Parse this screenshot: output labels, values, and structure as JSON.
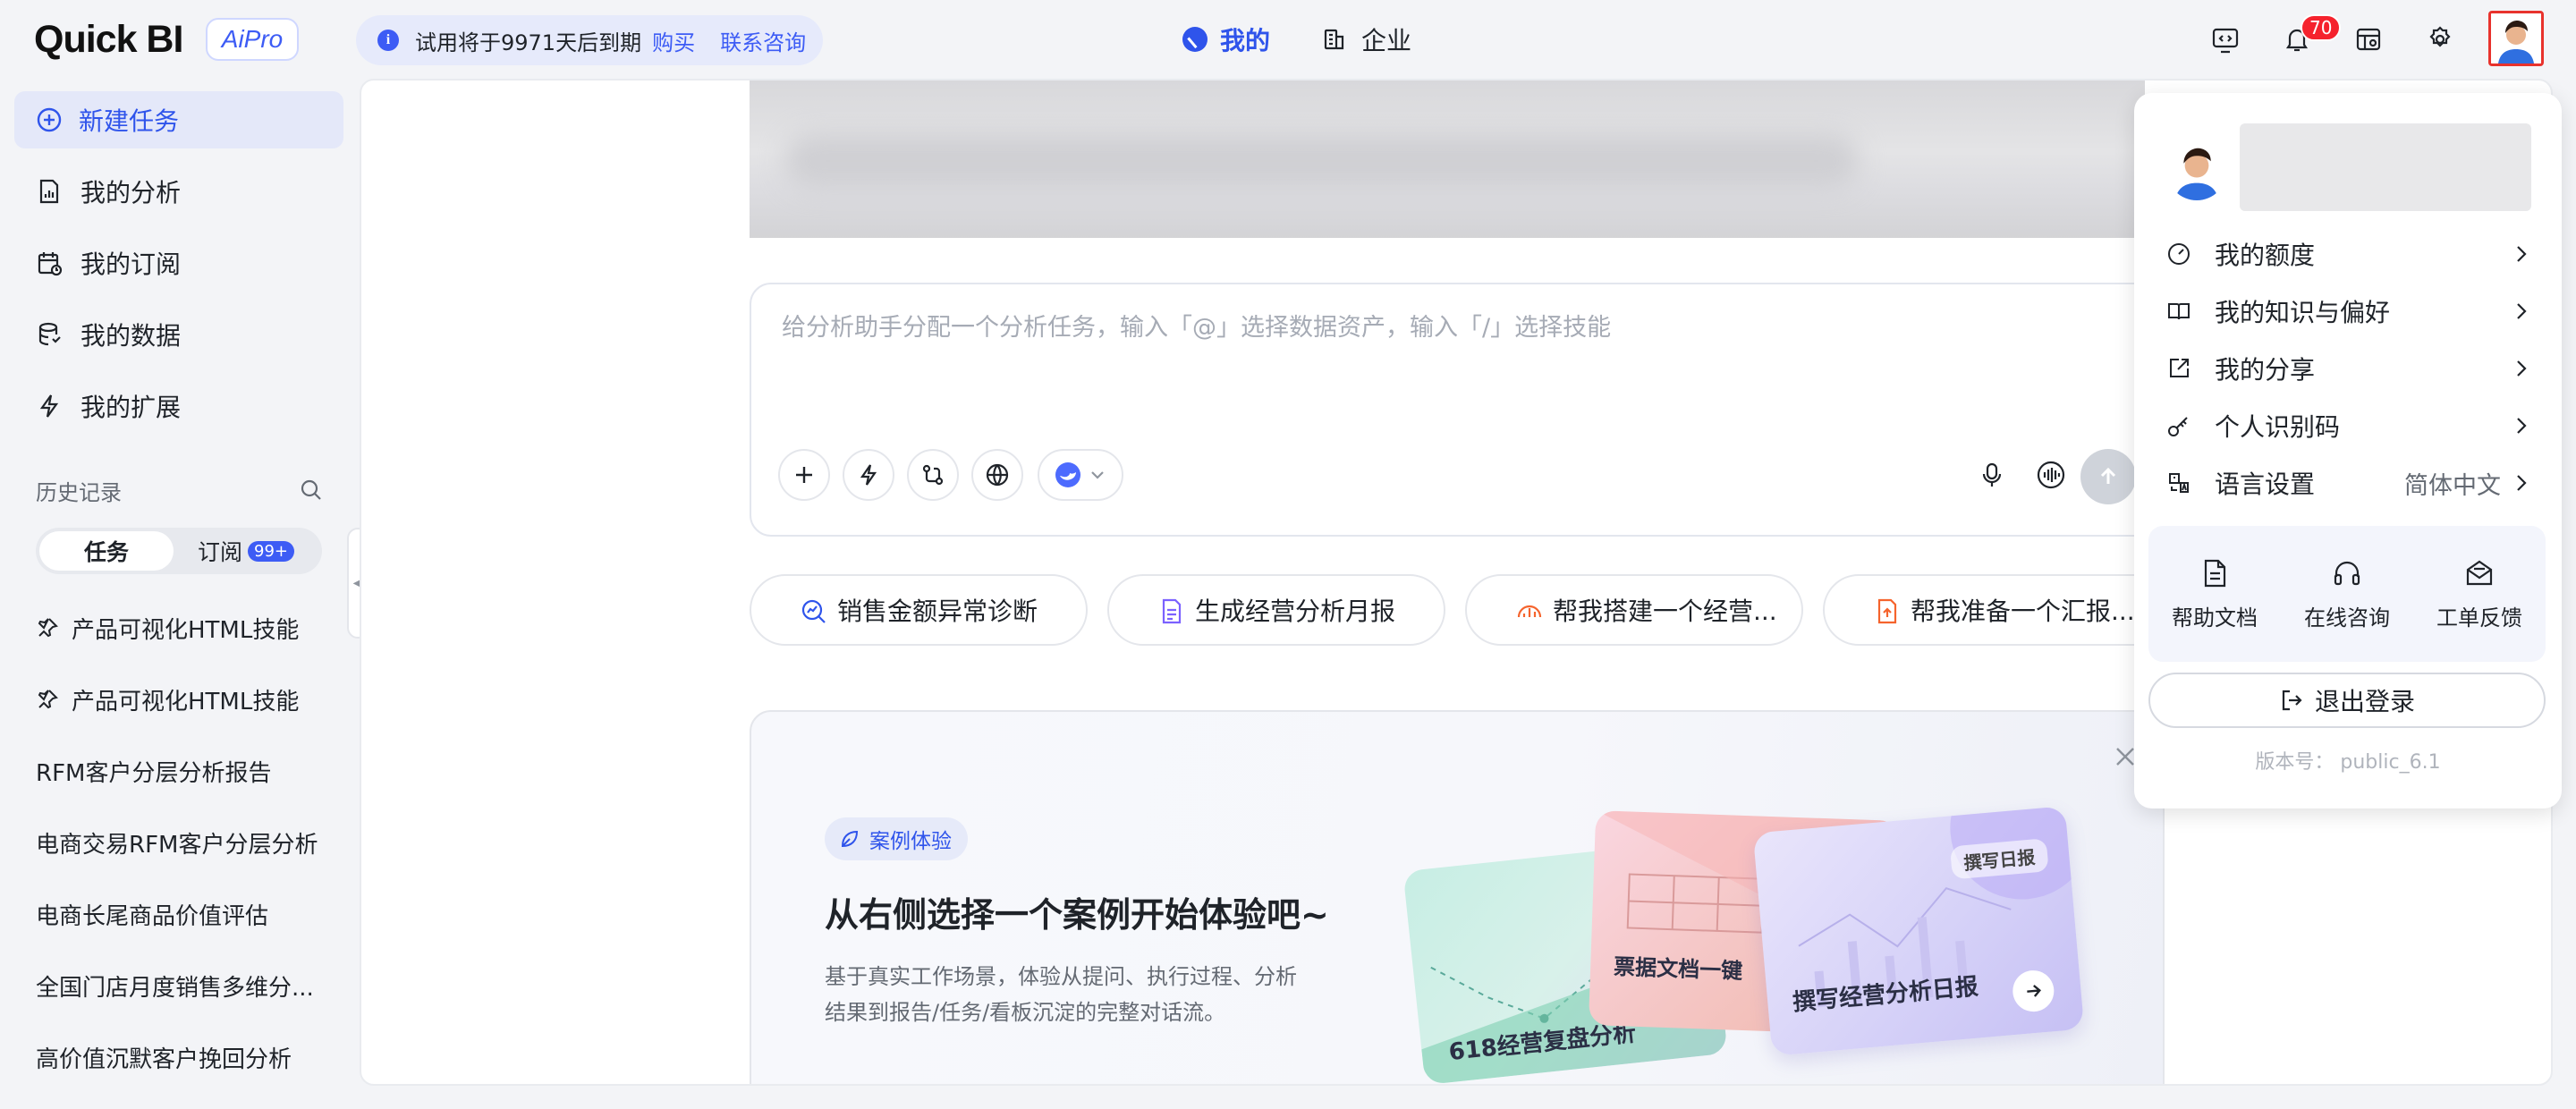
{
  "header": {
    "logo": "Quick BI",
    "aipro": "AiPro",
    "trial_text": "试用将于9971天后到期",
    "buy_link": "购买",
    "contact_link": "联系咨询",
    "tab_mine": "我的",
    "tab_enterprise": "企业",
    "notification_count": "70"
  },
  "sidebar": {
    "new_task": "新建任务",
    "items": [
      {
        "label": "我的分析",
        "icon": "chart-file-icon"
      },
      {
        "label": "我的订阅",
        "icon": "calendar-icon"
      },
      {
        "label": "我的数据",
        "icon": "database-icon"
      },
      {
        "label": "我的扩展",
        "icon": "lightning-icon"
      }
    ],
    "history_label": "历史记录",
    "segment_tasks": "任务",
    "segment_subscriptions": "订阅",
    "subscription_badge": "99+",
    "history": [
      {
        "label": "产品可视化HTML技能",
        "pinned": true
      },
      {
        "label": "产品可视化HTML技能",
        "pinned": true
      },
      {
        "label": "RFM客户分层分析报告",
        "pinned": false
      },
      {
        "label": "电商交易RFM客户分层分析",
        "pinned": false
      },
      {
        "label": "电商长尾商品价值评估",
        "pinned": false
      },
      {
        "label": "全国门店月度销售多维分...",
        "pinned": false
      },
      {
        "label": "高价值沉默客户挽回分析",
        "pinned": false
      }
    ]
  },
  "chat": {
    "placeholder": "给分析助手分配一个分析任务，输入「@」选择数据资产，输入「/」选择技能"
  },
  "suggestions": [
    {
      "label": "销售金额异常诊断",
      "icon": "search-chart-icon",
      "color": "#2f54eb"
    },
    {
      "label": "生成经营分析月报",
      "icon": "report-icon",
      "color": "#7b61ff"
    },
    {
      "label": "帮我搭建一个经营...",
      "icon": "dashboard-icon",
      "color": "#f5642d"
    },
    {
      "label": "帮我准备一个汇报...",
      "icon": "upload-file-icon",
      "color": "#f5642d"
    }
  ],
  "case": {
    "tag": "案例体验",
    "title": "从右侧选择一个案例开始体验吧~",
    "desc_line1": "基于真实工作场景，体验从提问、执行过程、分析",
    "desc_line2": "结果到报告/任务/看板沉淀的完整对话流。",
    "card_a": "618经营复盘分析",
    "card_b": "票据文档一键",
    "card_c": "撰写经营分析日报",
    "card_c_tag": "撰写日报"
  },
  "dropdown": {
    "items": [
      {
        "label": "我的额度",
        "icon": "gauge-icon"
      },
      {
        "label": "我的知识与偏好",
        "icon": "book-icon"
      },
      {
        "label": "我的分享",
        "icon": "share-icon"
      },
      {
        "label": "个人识别码",
        "icon": "key-icon"
      },
      {
        "label": "语言设置",
        "icon": "translate-icon",
        "value": "简体中文"
      }
    ],
    "help_docs": "帮助文档",
    "online_consult": "在线咨询",
    "ticket_feedback": "工单反馈",
    "logout": "退出登录",
    "version": "版本号： public_6.1"
  }
}
